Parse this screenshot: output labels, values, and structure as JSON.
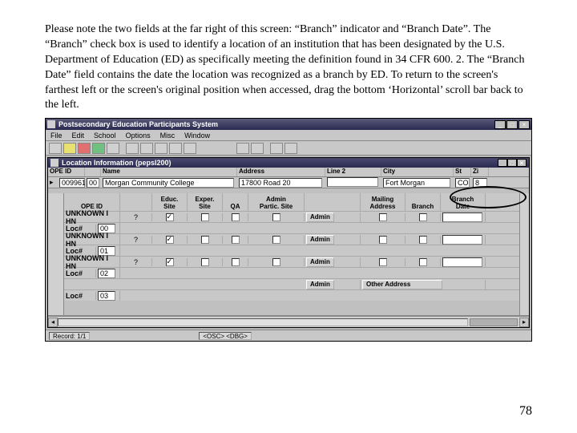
{
  "para": "Please note the two fields at the far right of this screen: “Branch” indicator and “Branch Date”. The “Branch” check box is used to identify a location of an institution that has been designated by the U.S. Department of Education (ED) as specifically meeting the definition found in 34 CFR 600. 2. The “Branch Date” field contains the date the location was recognized as a branch by ED. To return to the screen's farthest left or the screen's original position when accessed, drag the bottom ‘Horizontal’ scroll bar back to the left.",
  "app": {
    "title": "Postsecondary Education Participants System",
    "menus": [
      "File",
      "Edit",
      "School",
      "Options",
      "Misc",
      "Window"
    ],
    "doc_title": "Location Information (pepsl200)",
    "top_headers": {
      "c1": "OPE ID",
      "c2": "",
      "c3": "Name",
      "c4": "Address",
      "c5": "Line 2",
      "c6": "City",
      "c7": "St",
      "c8": "Zi"
    },
    "top_row": {
      "ope": "009961",
      "loc": "00",
      "name": "Morgan Community College",
      "addr": "17800 Road 20",
      "line2": "",
      "city": "Fort Morgan",
      "st": "CO",
      "zip": "8"
    },
    "grid_headers": {
      "c0": "OPE ID",
      "c1": "",
      "c2": "Educ.\nSite",
      "c3": "Exper.\nSite",
      "c4": "QA",
      "c5": "Admin\nPartic. Site",
      "c6": "",
      "c7": "Mailing\nAddress",
      "c8": "Branch",
      "c9": "Branch\nDate"
    },
    "rows": [
      {
        "label": "UNKNOWN I HN",
        "loc": "Loc#",
        "locn": "00",
        "admin": "Admin",
        "other": ""
      },
      {
        "label": "UNKNOWN I HN",
        "loc": "Loc#",
        "locn": "01",
        "admin": "Admin",
        "other": ""
      },
      {
        "label": "UNKNOWN I HN",
        "loc": "Loc#",
        "locn": "02",
        "admin": "Admin",
        "other": ""
      },
      {
        "label": "",
        "loc": "Loc#",
        "locn": "03",
        "admin": "Admin",
        "other": "Other Address"
      }
    ],
    "status": {
      "record": "Record: 1/1",
      "mode": "<OSC> <DBG>"
    }
  },
  "pagenum": "78"
}
